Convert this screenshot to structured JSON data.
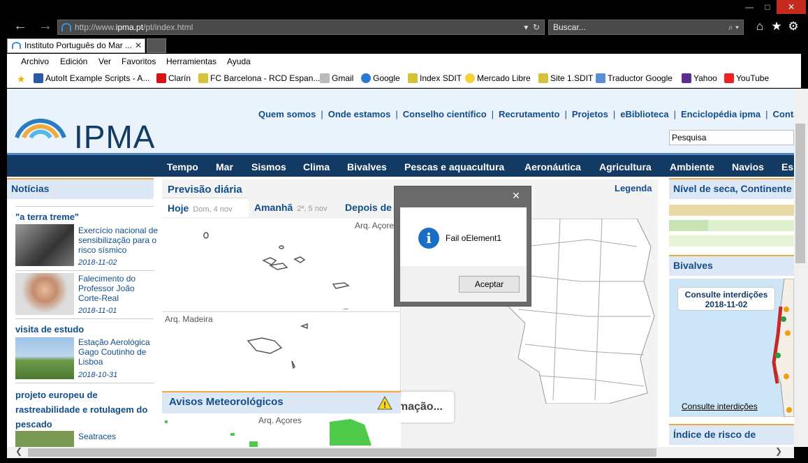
{
  "browser": {
    "window_controls": {
      "minimize": "—",
      "maximize": "□",
      "close": "✕"
    },
    "address": {
      "prefix": "http://www.",
      "domain": "ipma.pt",
      "path": "/pt/index.html"
    },
    "search_placeholder": "Buscar...",
    "tab_title": "Instituto Português do Mar ...",
    "menu": [
      "Archivo",
      "Edición",
      "Ver",
      "Favoritos",
      "Herramientas",
      "Ayuda"
    ],
    "favorites": [
      "AutoIt Example Scripts - A...",
      "Clarín",
      "FC Barcelona - RCD Espan...",
      "Gmail",
      "Google",
      "Index SDIT",
      "Mercado Libre",
      "Site 1.SDIT",
      "Traductor Google",
      "Yahoo",
      "YouTube"
    ]
  },
  "site": {
    "logo": "IPMA",
    "top_links": [
      "Quem somos",
      "Onde estamos",
      "Conselho científico",
      "Recrutamento",
      "Projetos",
      "eBiblioteca",
      "Enciclopédia ipma",
      "Contactos"
    ],
    "search_value": "Pesquisa",
    "nav": [
      "Tempo",
      "Mar",
      "Sismos",
      "Clima",
      "Bivalves",
      "Pescas e aquacultura",
      "Aeronáutica",
      "Agricultura",
      "Ambiente",
      "Navios",
      "Es"
    ]
  },
  "news": {
    "header": "Notícias",
    "items": [
      {
        "section": "\"a terra treme\"",
        "title": "Exercício nacional de sensibilização para o risco sísmico",
        "date": "2018-11-02"
      },
      {
        "section": "",
        "title": "Falecimento do Professor João Corte-Real",
        "date": "2018-11-01"
      },
      {
        "section": "visita de estudo",
        "title": "Estação Aerológica Gago Coutinho de Lisboa",
        "date": "2018-10-31"
      },
      {
        "section": "projeto europeu de rastreabilidade e rotulagem do pescado",
        "title": "Seatraces",
        "date": ""
      }
    ]
  },
  "forecast": {
    "title": "Previsão diária",
    "legend": "Legenda",
    "tabs": [
      {
        "label": "Hoje",
        "sub": "Dom, 4 nov"
      },
      {
        "label": "Amanhã",
        "sub": "2ª, 5 nov"
      },
      {
        "label": "Depois de",
        "sub": ""
      }
    ],
    "label_azores": "Arq. Açores",
    "label_madeira": "Arq. Madeira",
    "no_info": "Sem informação...",
    "warnings_title": "Avisos Meteorológicos",
    "warnings_azores": "Arq. Açores"
  },
  "right": {
    "drought_title": "Nível de seca, Continente",
    "bivalves_title": "Bivalves",
    "interdictions_box": "Consulte interdições",
    "interdictions_date": "2018-11-02",
    "interdictions_link": "Consulte interdições",
    "fire_title": "Índice de risco de incêndio"
  },
  "dialog": {
    "close": "✕",
    "message": "Fail oElement1",
    "ok": "Aceptar"
  }
}
